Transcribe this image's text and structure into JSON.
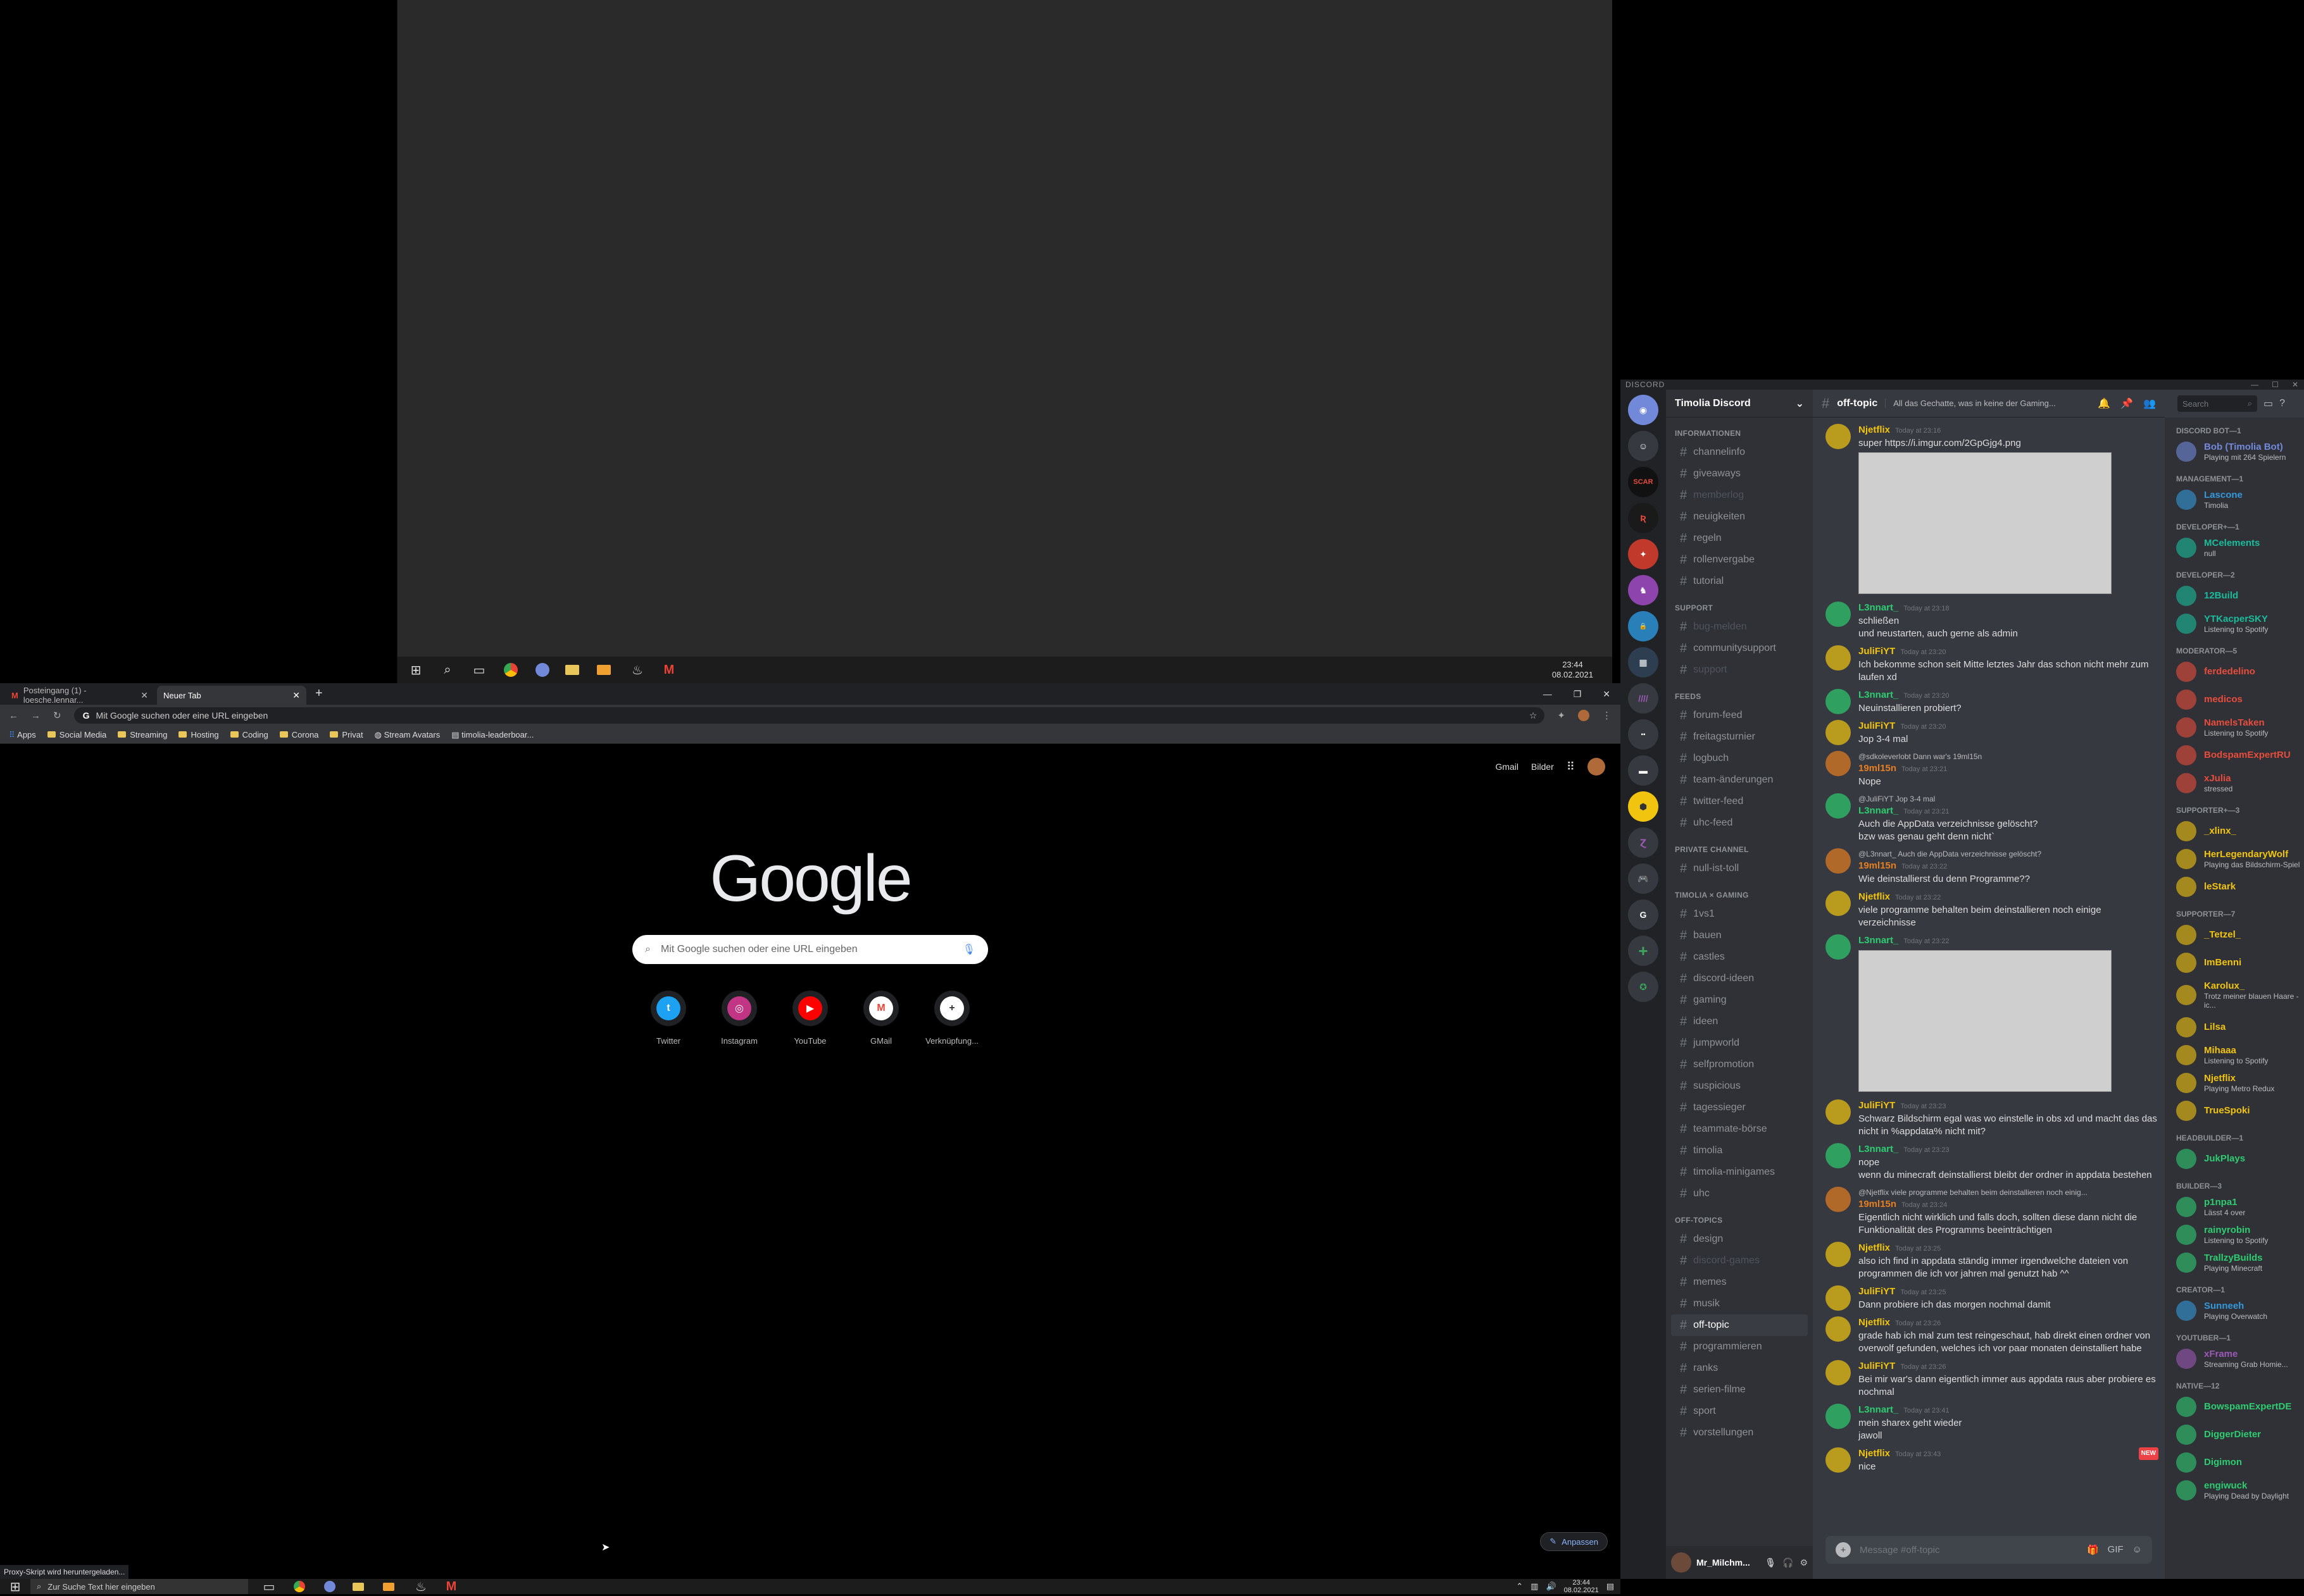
{
  "top_window": {
    "clock_time": "23:44",
    "clock_date": "08.02.2021"
  },
  "chrome": {
    "tabs": [
      {
        "label": "Posteingang (1) - loesche.lennar..."
      },
      {
        "label": "Neuer Tab"
      }
    ],
    "url_placeholder": "Mit Google suchen oder eine URL eingeben",
    "bookmarks": [
      "Apps",
      "Social Media",
      "Streaming",
      "Hosting",
      "Coding",
      "Corona",
      "Privat",
      "Stream Avatars",
      "timolia-leaderboar..."
    ],
    "top_links": {
      "gmail": "Gmail",
      "images": "Bilder"
    },
    "logo": "Google",
    "search_placeholder": "Mit Google suchen oder eine URL eingeben",
    "shortcuts": [
      {
        "label": "Twitter",
        "color": "#1da1f2"
      },
      {
        "label": "Instagram",
        "color": "#c13584"
      },
      {
        "label": "YouTube",
        "color": "#ff0000"
      },
      {
        "label": "GMail",
        "color": "#ea4335"
      },
      {
        "label": "Verknüpfung...",
        "color": "#202124"
      }
    ],
    "customize": "Anpassen",
    "status": "Proxy-Skript wird heruntergeladen..."
  },
  "taskbar": {
    "search_placeholder": "Zur Suche Text hier eingeben",
    "time": "23:44",
    "date": "08.02.2021"
  },
  "discord": {
    "app_title": "DISCORD",
    "server": "Timolia Discord",
    "channel_categories": [
      {
        "name": "INFORMATIONEN",
        "channels": [
          {
            "n": "channelinfo"
          },
          {
            "n": "giveaways"
          },
          {
            "n": "memberlog",
            "m": true
          },
          {
            "n": "neuigkeiten"
          },
          {
            "n": "regeln"
          },
          {
            "n": "rollenvergabe"
          },
          {
            "n": "tutorial"
          }
        ]
      },
      {
        "name": "SUPPORT",
        "channels": [
          {
            "n": "bug-melden",
            "m": true
          },
          {
            "n": "communitysupport"
          },
          {
            "n": "support",
            "m": true
          }
        ]
      },
      {
        "name": "FEEDS",
        "channels": [
          {
            "n": "forum-feed"
          },
          {
            "n": "freitagsturnier"
          },
          {
            "n": "logbuch"
          },
          {
            "n": "team-änderungen"
          },
          {
            "n": "twitter-feed"
          },
          {
            "n": "uhc-feed"
          }
        ]
      },
      {
        "name": "PRIVATE CHANNEL",
        "channels": [
          {
            "n": "null-ist-toll"
          }
        ]
      },
      {
        "name": "TIMOLIA × GAMING",
        "channels": [
          {
            "n": "1vs1"
          },
          {
            "n": "bauen"
          },
          {
            "n": "castles"
          },
          {
            "n": "discord-ideen"
          },
          {
            "n": "gaming"
          },
          {
            "n": "ideen"
          },
          {
            "n": "jumpworld"
          },
          {
            "n": "selfpromotion"
          },
          {
            "n": "suspicious"
          },
          {
            "n": "tagessieger"
          },
          {
            "n": "teammate-börse"
          },
          {
            "n": "timolia"
          },
          {
            "n": "timolia-minigames"
          },
          {
            "n": "uhc"
          }
        ]
      },
      {
        "name": "OFF-TOPICS",
        "channels": [
          {
            "n": "design"
          },
          {
            "n": "discord-games",
            "m": true
          },
          {
            "n": "memes"
          },
          {
            "n": "musik"
          },
          {
            "n": "off-topic",
            "s": true
          },
          {
            "n": "programmieren"
          },
          {
            "n": "ranks"
          },
          {
            "n": "serien-filme"
          },
          {
            "n": "sport"
          },
          {
            "n": "vorstellungen"
          }
        ]
      }
    ],
    "channel": "off-topic",
    "topic": "All das Gechatte, was in keine der Gaming...",
    "search_placeholder": "Search",
    "user": "Mr_Milchm...",
    "input_placeholder": "Message #off-topic",
    "messages": [
      {
        "author": "Njetflix",
        "color": "#f1c40f",
        "time": "Today at 23:16",
        "lines": [
          "super https://i.imgur.com/2GpGjg4.png"
        ],
        "image": true
      },
      {
        "author": "L3nnart_",
        "color": "#2ecc71",
        "time": "Today at 23:18",
        "lines": [
          "schließen",
          "und neustarten, auch gerne als admin"
        ]
      },
      {
        "author": "JuliFiYT",
        "color": "#f1c40f",
        "time": "Today at 23:20",
        "lines": [
          "Ich bekomme schon seit Mitte letztes Jahr das schon nicht mehr zum laufen xd"
        ]
      },
      {
        "author": "L3nnart_",
        "color": "#2ecc71",
        "time": "Today at 23:20",
        "lines": [
          "Neuinstallieren probiert?"
        ]
      },
      {
        "author": "JuliFiYT",
        "color": "#f1c40f",
        "time": "Today at 23:20",
        "lines": [
          "Jop 3-4 mal"
        ]
      },
      {
        "reply": "@sdkoleverlobt Dann war's 19ml15n",
        "author": "19ml15n",
        "color": "#e67e22",
        "time": "Today at 23:21",
        "lines": [
          "Nope"
        ]
      },
      {
        "reply": "@JuliFiYT Jop 3-4 mal",
        "author": "L3nnart_",
        "color": "#2ecc71",
        "time": "Today at 23:21",
        "lines": [
          "Auch die AppData verzeichnisse gelöscht?",
          "bzw was genau geht denn nicht`"
        ]
      },
      {
        "reply": "@L3nnart_ Auch die AppData verzeichnisse gelöscht?",
        "author": "19ml15n",
        "color": "#e67e22",
        "time": "Today at 23:22",
        "lines": [
          "Wie deinstallierst du denn Programme??"
        ]
      },
      {
        "author": "Njetflix",
        "color": "#f1c40f",
        "time": "Today at 23:22",
        "lines": [
          "viele programme behalten beim deinstallieren noch einige verzeichnisse"
        ]
      },
      {
        "author": "L3nnart_",
        "color": "#2ecc71",
        "time": "Today at 23:22",
        "lines": [],
        "image": true
      },
      {
        "author": "JuliFiYT",
        "color": "#f1c40f",
        "time": "Today at 23:23",
        "lines": [
          "Schwarz Bildschirm egal was wo einstelle in obs xd und macht das das nicht in %appdata% nicht mit?"
        ]
      },
      {
        "author": "L3nnart_",
        "color": "#2ecc71",
        "time": "Today at 23:23",
        "lines": [
          "nope",
          "wenn du minecraft deinstallierst bleibt der ordner in appdata bestehen"
        ]
      },
      {
        "reply": "@Njetflix viele programme behalten beim deinstallieren noch einig...",
        "author": "19ml15n",
        "color": "#e67e22",
        "time": "Today at 23:24",
        "lines": [
          "Eigentlich nicht wirklich und falls doch, sollten diese dann nicht die Funktionalität des Programms beeinträchtigen"
        ]
      },
      {
        "author": "Njetflix",
        "color": "#f1c40f",
        "time": "Today at 23:25",
        "lines": [
          "also ich find in appdata ständig immer irgendwelche dateien von programmen die ich vor jahren mal genutzt hab ^^"
        ]
      },
      {
        "author": "JuliFiYT",
        "color": "#f1c40f",
        "time": "Today at 23:25",
        "lines": [
          "Dann probiere ich das morgen nochmal damit"
        ]
      },
      {
        "author": "Njetflix",
        "color": "#f1c40f",
        "time": "Today at 23:26",
        "lines": [
          "grade hab ich mal zum test reingeschaut, hab direkt einen ordner von overwolf gefunden, welches ich vor paar monaten deinstalliert habe"
        ]
      },
      {
        "author": "JuliFiYT",
        "color": "#f1c40f",
        "time": "Today at 23:26",
        "lines": [
          "Bei mir war's dann eigentlich immer aus appdata raus aber probiere es nochmal"
        ]
      },
      {
        "author": "L3nnart_",
        "color": "#2ecc71",
        "time": "Today at 23:41",
        "lines": [
          "mein sharex geht wieder",
          "jawoll"
        ]
      },
      {
        "author": "Njetflix",
        "color": "#f1c40f",
        "time": "Today at 23:43",
        "lines": [
          "nice"
        ],
        "new": "NEW"
      }
    ],
    "member_groups": [
      {
        "name": "DISCORD BOT—1",
        "members": [
          {
            "n": "Bob (Timolia Bot)",
            "c": "#7289da",
            "a": "Playing mit 264 Spielern"
          }
        ]
      },
      {
        "name": "MANAGEMENT—1",
        "members": [
          {
            "n": "Lascone",
            "c": "#3498db",
            "a": "Timolia"
          }
        ]
      },
      {
        "name": "DEVELOPER+—1",
        "members": [
          {
            "n": "MCelements",
            "c": "#1abc9c",
            "a": "null"
          }
        ]
      },
      {
        "name": "DEVELOPER—2",
        "members": [
          {
            "n": "12Build",
            "c": "#1abc9c",
            "a": ""
          },
          {
            "n": "YTKacperSKY",
            "c": "#1abc9c",
            "a": "Listening to Spotify"
          }
        ]
      },
      {
        "name": "MODERATOR—5",
        "members": [
          {
            "n": "ferdedelino",
            "c": "#e74c3c",
            "a": ""
          },
          {
            "n": "medicos",
            "c": "#e74c3c",
            "a": ""
          },
          {
            "n": "NamelsTaken",
            "c": "#e74c3c",
            "a": "Listening to Spotify"
          },
          {
            "n": "BodspamExpertRU",
            "c": "#e74c3c",
            "a": ""
          },
          {
            "n": "xJulia",
            "c": "#e74c3c",
            "a": "stressed"
          }
        ]
      },
      {
        "name": "SUPPORTER+—3",
        "members": [
          {
            "n": "_xlinx_",
            "c": "#f1c40f",
            "a": ""
          },
          {
            "n": "HerLegendaryWolf",
            "c": "#f1c40f",
            "a": "Playing das Bildschirm-Spiel"
          },
          {
            "n": "leStark",
            "c": "#f1c40f",
            "a": ""
          }
        ]
      },
      {
        "name": "SUPPORTER—7",
        "members": [
          {
            "n": "_Tetzel_",
            "c": "#f1c40f",
            "a": ""
          },
          {
            "n": "ImBenni",
            "c": "#f1c40f",
            "a": ""
          },
          {
            "n": "Karolux_",
            "c": "#f1c40f",
            "a": "Trotz meiner blauen Haare - ic..."
          },
          {
            "n": "Lilsa",
            "c": "#f1c40f",
            "a": ""
          },
          {
            "n": "Mihaaa",
            "c": "#f1c40f",
            "a": "Listening to Spotify"
          },
          {
            "n": "Njetflix",
            "c": "#f1c40f",
            "a": "Playing Metro Redux"
          },
          {
            "n": "TrueSpoki",
            "c": "#f1c40f",
            "a": ""
          }
        ]
      },
      {
        "name": "HEADBUILDER—1",
        "members": [
          {
            "n": "JukPlays",
            "c": "#2ecc71",
            "a": ""
          }
        ]
      },
      {
        "name": "BUILDER—3",
        "members": [
          {
            "n": "p1npa1",
            "c": "#2ecc71",
            "a": "Lässt 4 over"
          },
          {
            "n": "rainyrobin",
            "c": "#2ecc71",
            "a": "Listening to Spotify"
          },
          {
            "n": "TrallzyBuilds",
            "c": "#2ecc71",
            "a": "Playing Minecraft"
          }
        ]
      },
      {
        "name": "CREATOR—1",
        "members": [
          {
            "n": "Sunneeh",
            "c": "#3498db",
            "a": "Playing Overwatch"
          }
        ]
      },
      {
        "name": "YOUTUBER—1",
        "members": [
          {
            "n": "xFrame",
            "c": "#9b59b6",
            "a": "Streaming Grab Homie..."
          }
        ]
      },
      {
        "name": "NATIVE—12",
        "members": [
          {
            "n": "BowspamExpertDE",
            "c": "#2ecc71",
            "a": ""
          },
          {
            "n": "DiggerDieter",
            "c": "#2ecc71",
            "a": ""
          },
          {
            "n": "Digimon",
            "c": "#2ecc71",
            "a": ""
          },
          {
            "n": "engiwuck",
            "c": "#2ecc71",
            "a": "Playing Dead by Daylight"
          }
        ]
      }
    ]
  }
}
